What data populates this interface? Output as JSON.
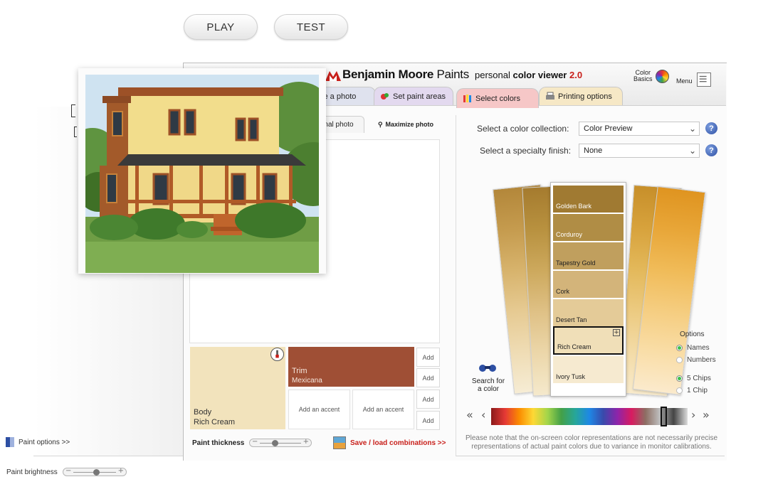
{
  "top_buttons": {
    "play": "PLAY",
    "test": "TEST"
  },
  "header": {
    "brand": "Benjamin Moore",
    "brand_suffix": "Paints",
    "app_prefix": "personal ",
    "app_name": "color viewer",
    "version": "2.0",
    "color_basics_l1": "Color",
    "color_basics_l2": "Basics",
    "menu": "Menu"
  },
  "tabs": {
    "choose_photo": "se a photo",
    "set_paint_areas": "Set paint areas",
    "select_colors": "Select colors",
    "printing_options": "Printing options"
  },
  "photo_tabs": {
    "original": "nal photo",
    "maximize": "Maximize photo"
  },
  "paint_areas": {
    "body_label": "Body",
    "body_color": "Rich Cream",
    "trim_label": "Trim",
    "trim_color": "Mexicana",
    "accent1": "Add an accent",
    "accent2": "Add an accent",
    "add_buttons": [
      "Add",
      "Add",
      "Add",
      "Add"
    ]
  },
  "bottom_bar": {
    "paint_thickness": "Paint thickness",
    "slider_minus": "−",
    "slider_plus": "+",
    "save_load": "Save / load combinations >>",
    "paint_options": "Paint options >>",
    "paint_brightness": "Paint brightness",
    "thickness_level": 0.35,
    "brightness_level": 0.55
  },
  "collection": {
    "label": "Select a color collection:",
    "value": "Color Preview"
  },
  "finish": {
    "label": "Select a specialty finish:",
    "value": "None"
  },
  "help": "?",
  "chips": [
    {
      "name": "Golden Bark",
      "color": "#a07a32"
    },
    {
      "name": "Corduroy",
      "color": "#b08d45"
    },
    {
      "name": "Tapestry Gold",
      "color": "#c09f5e"
    },
    {
      "name": "Cork",
      "color": "#d3b47a"
    },
    {
      "name": "Desert Tan",
      "color": "#e4cb98"
    },
    {
      "name": "Rich Cream",
      "color": "#f0dfb8"
    },
    {
      "name": "Ivory Tusk",
      "color": "#f6ead0"
    }
  ],
  "search": {
    "l1": "Search for",
    "l2": "a color"
  },
  "options": {
    "title": "Options",
    "names": "Names",
    "numbers": "Numbers",
    "five_chips": "5 Chips",
    "one_chip": "1 Chip"
  },
  "spectrum_nav": {
    "first": "«",
    "prev": "‹",
    "next": "›",
    "last": "»"
  },
  "note": "Please note that the on-screen color representations are not necessarily precise representations of actual paint colors due to variance in monitor calibrations.",
  "colors": {
    "trim": "#9f4f35",
    "body": "#f2e3bc",
    "accent_red": "#c8201b"
  }
}
